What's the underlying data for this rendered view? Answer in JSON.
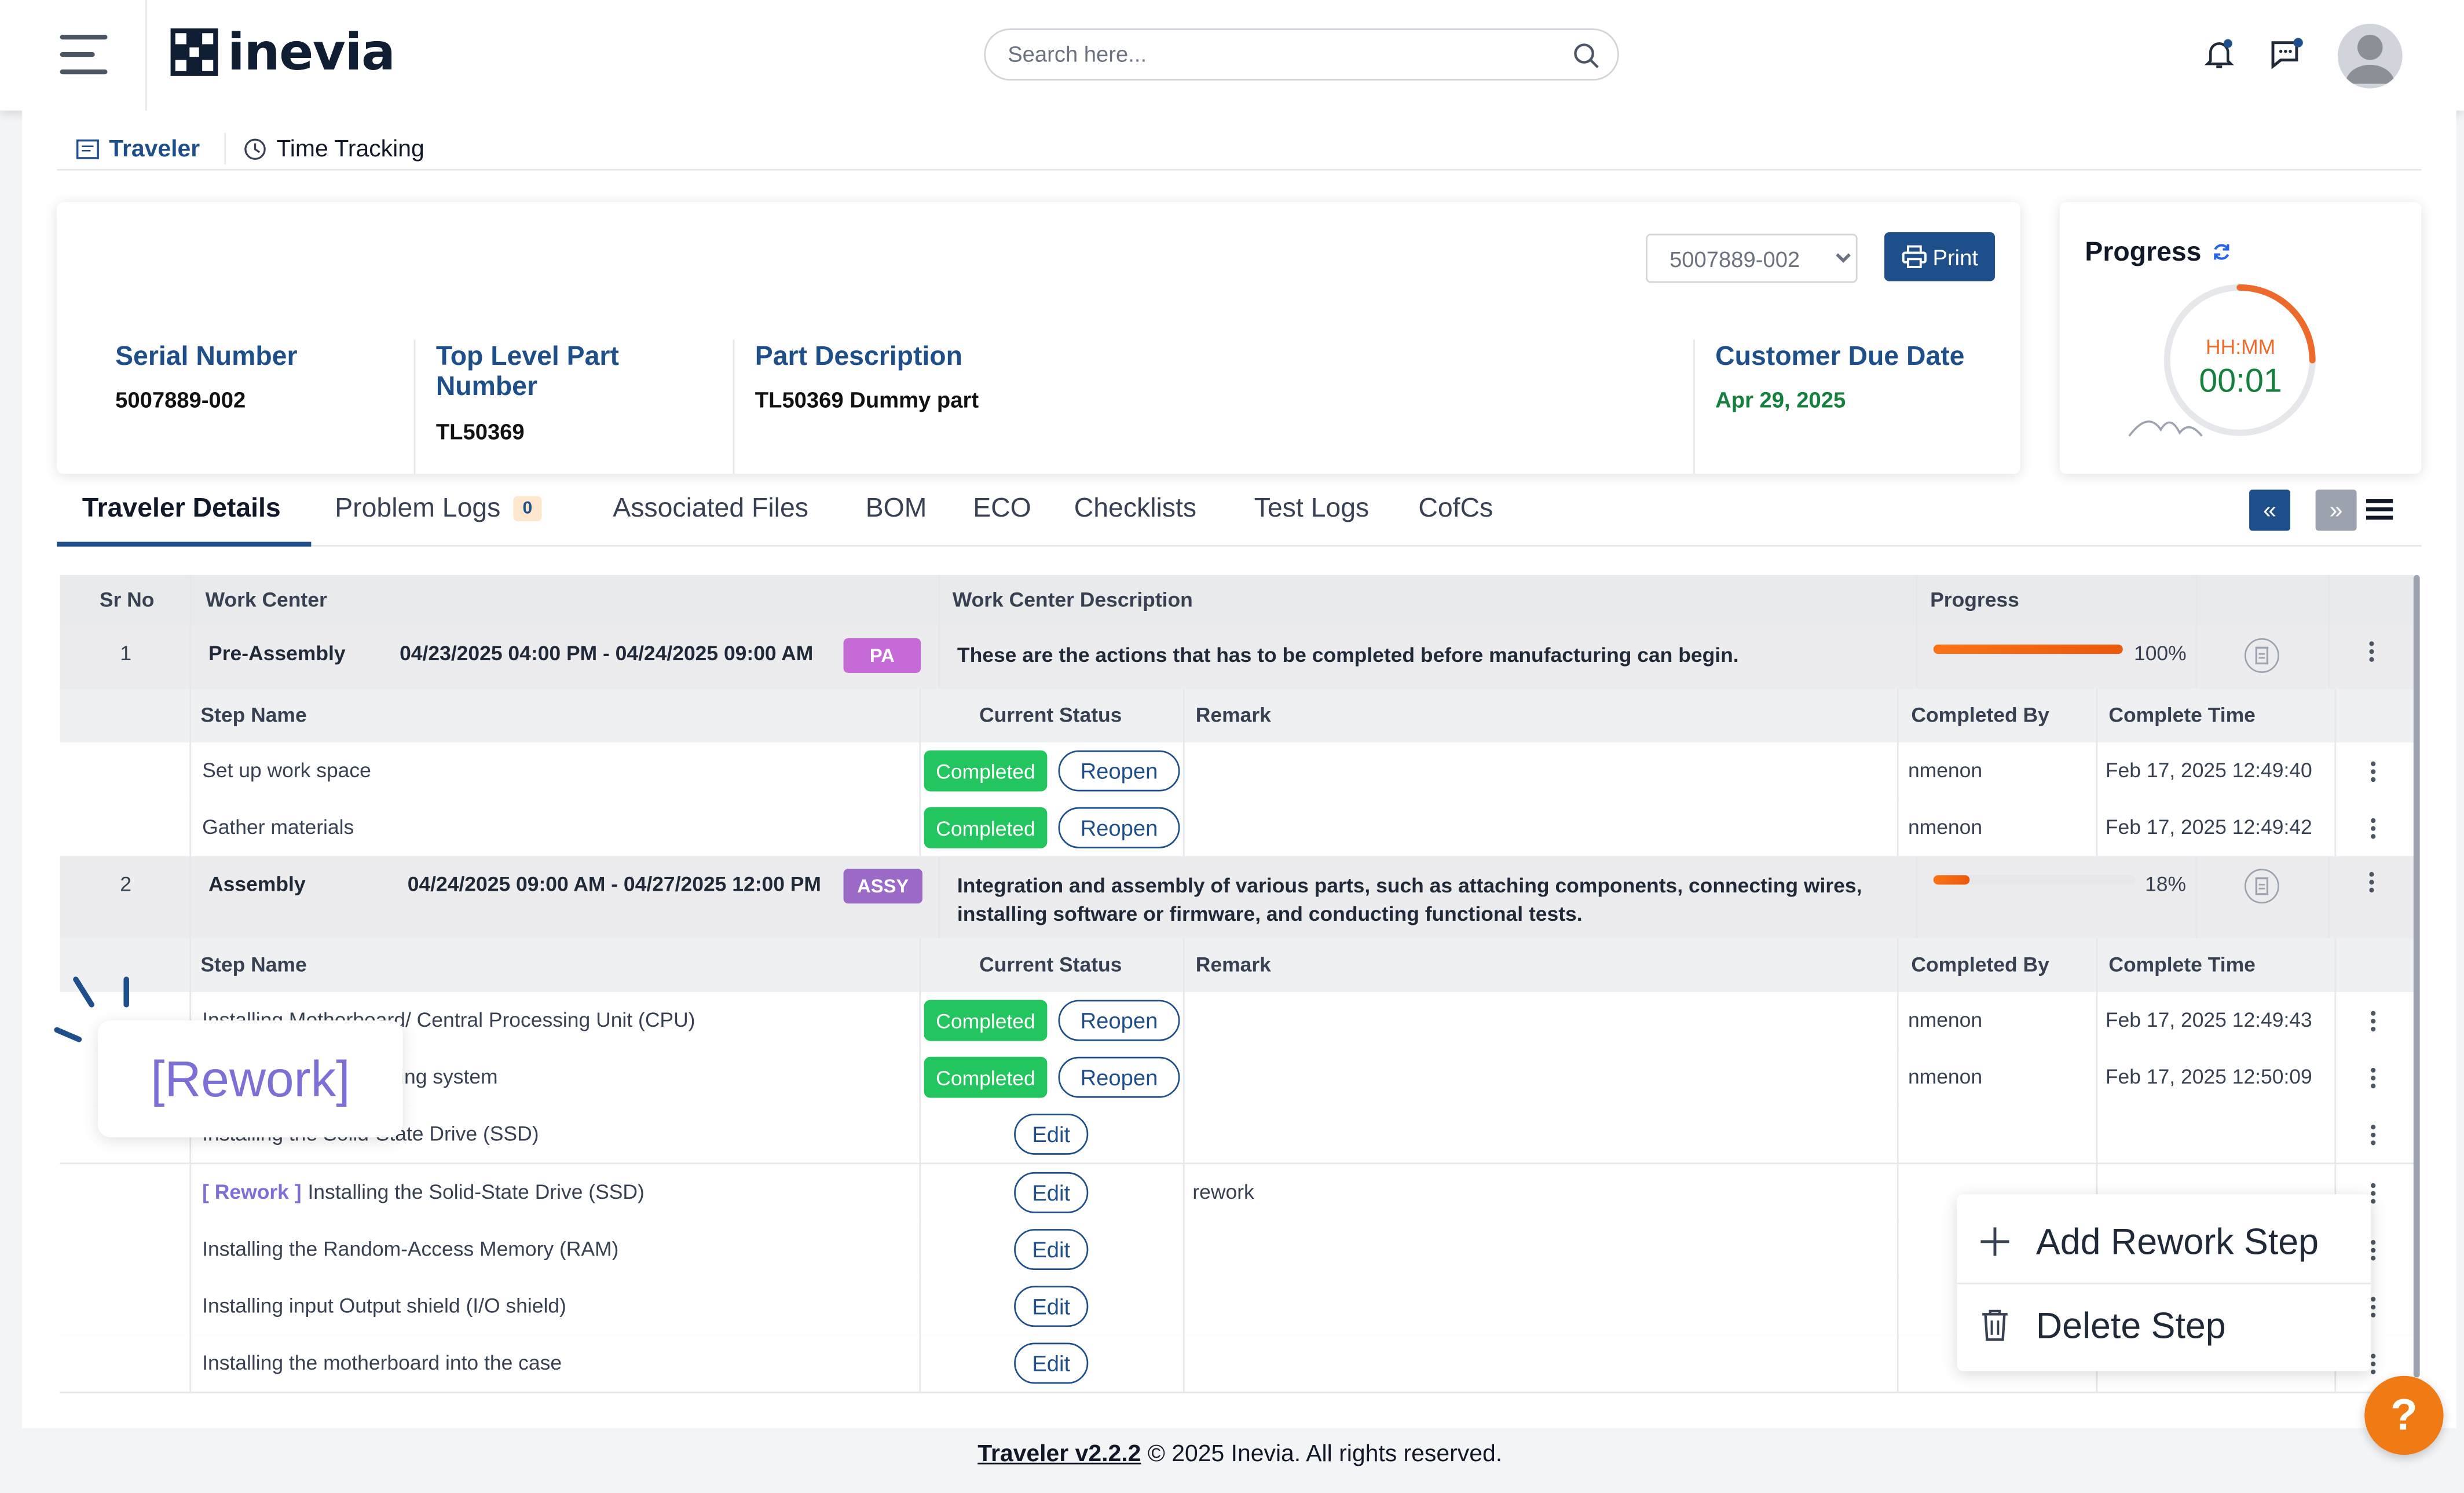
{
  "header": {
    "logo_text": "inevia",
    "search_placeholder": "Search here..."
  },
  "subnav": {
    "traveler": "Traveler",
    "time_tracking": "Time Tracking"
  },
  "info": {
    "serial_label": "Serial Number",
    "serial_value": "5007889-002",
    "part_number_label": "Top Level Part Number",
    "part_number_value": "TL50369",
    "part_desc_label": "Part Description",
    "part_desc_value": "TL50369 Dummy part",
    "due_date_label": "Customer Due Date",
    "due_date_value": "Apr 29, 2025",
    "select_value": "5007889-002",
    "print_label": "Print"
  },
  "progress": {
    "title": "Progress",
    "unit": "HH:MM",
    "time": "00:01"
  },
  "tabs": [
    {
      "label": "Traveler Details",
      "active": true
    },
    {
      "label": "Problem Logs",
      "badge": "0"
    },
    {
      "label": "Associated Files"
    },
    {
      "label": "BOM"
    },
    {
      "label": "ECO"
    },
    {
      "label": "Checklists"
    },
    {
      "label": "Test Logs"
    },
    {
      "label": "CofCs"
    }
  ],
  "table": {
    "headers": {
      "sr": "Sr No",
      "wc": "Work Center",
      "desc": "Work Center Description",
      "progress": "Progress"
    },
    "step_headers": {
      "name": "Step Name",
      "status": "Current Status",
      "remark": "Remark",
      "by": "Completed By",
      "time": "Complete Time"
    },
    "work_centers": [
      {
        "sr": "1",
        "name": "Pre-Assembly",
        "dates": "04/23/2025 04:00 PM - 04/24/2025 09:00 AM",
        "tag": "PA",
        "tag_color": "#c56ad6",
        "description": "These are the actions that has to be completed before manufacturing can begin.",
        "progress_pct": 100,
        "progress_text": "100%",
        "steps": [
          {
            "name": "Set up work space",
            "status": "Completed",
            "action": "Reopen",
            "remark": "",
            "by": "nmenon",
            "time": "Feb 17, 2025 12:49:40"
          },
          {
            "name": "Gather materials",
            "status": "Completed",
            "action": "Reopen",
            "remark": "",
            "by": "nmenon",
            "time": "Feb 17, 2025 12:49:42"
          }
        ]
      },
      {
        "sr": "2",
        "name": "Assembly",
        "dates": "04/24/2025 09:00 AM - 04/27/2025 12:00 PM",
        "tag": "ASSY",
        "tag_color": "#9a6ac6",
        "description": "Integration and assembly of various parts, such as attaching components, connecting wires, installing software or firmware, and conducting functional tests.",
        "progress_pct": 18,
        "progress_text": "18%",
        "steps": [
          {
            "name": "Installing Motherboard/ Central Processing Unit (CPU)",
            "status": "Completed",
            "action": "Reopen",
            "remark": "",
            "by": "nmenon",
            "time": "Feb 17, 2025 12:49:43"
          },
          {
            "name": "ste/ Installing the cooling system",
            "status": "Completed",
            "action": "Reopen",
            "remark": "",
            "by": "nmenon",
            "time": "Feb 17, 2025 12:50:09"
          },
          {
            "name": "Installing the Solid-State Drive (SSD)",
            "status": "",
            "action": "Edit",
            "remark": "",
            "by": "",
            "time": ""
          },
          {
            "prefix": "[ Rework ]",
            "name": "Installing the Solid-State Drive (SSD)",
            "status": "",
            "action": "Edit",
            "remark": "rework",
            "by": "",
            "time": ""
          },
          {
            "name": "Installing the Random-Access Memory (RAM)",
            "status": "",
            "action": "Edit",
            "remark": "",
            "by": "",
            "time": ""
          },
          {
            "name": "Installing input Output shield (I/O shield)",
            "status": "",
            "action": "Edit",
            "remark": "",
            "by": "",
            "time": ""
          },
          {
            "name": "Installing the motherboard into the case",
            "status": "",
            "action": "Edit",
            "remark": "",
            "by": "",
            "time": ""
          }
        ]
      }
    ]
  },
  "context_menu": {
    "add": "Add Rework Step",
    "delete": "Delete Step"
  },
  "tooltip": "[Rework]",
  "help": "?",
  "footer": {
    "link": "Traveler v2.2.2",
    "text": " © 2025 Inevia. All rights reserved."
  },
  "colors": {
    "brand": "#1f4f8a",
    "completed": "#22c55e",
    "accent": "#f07a13"
  }
}
